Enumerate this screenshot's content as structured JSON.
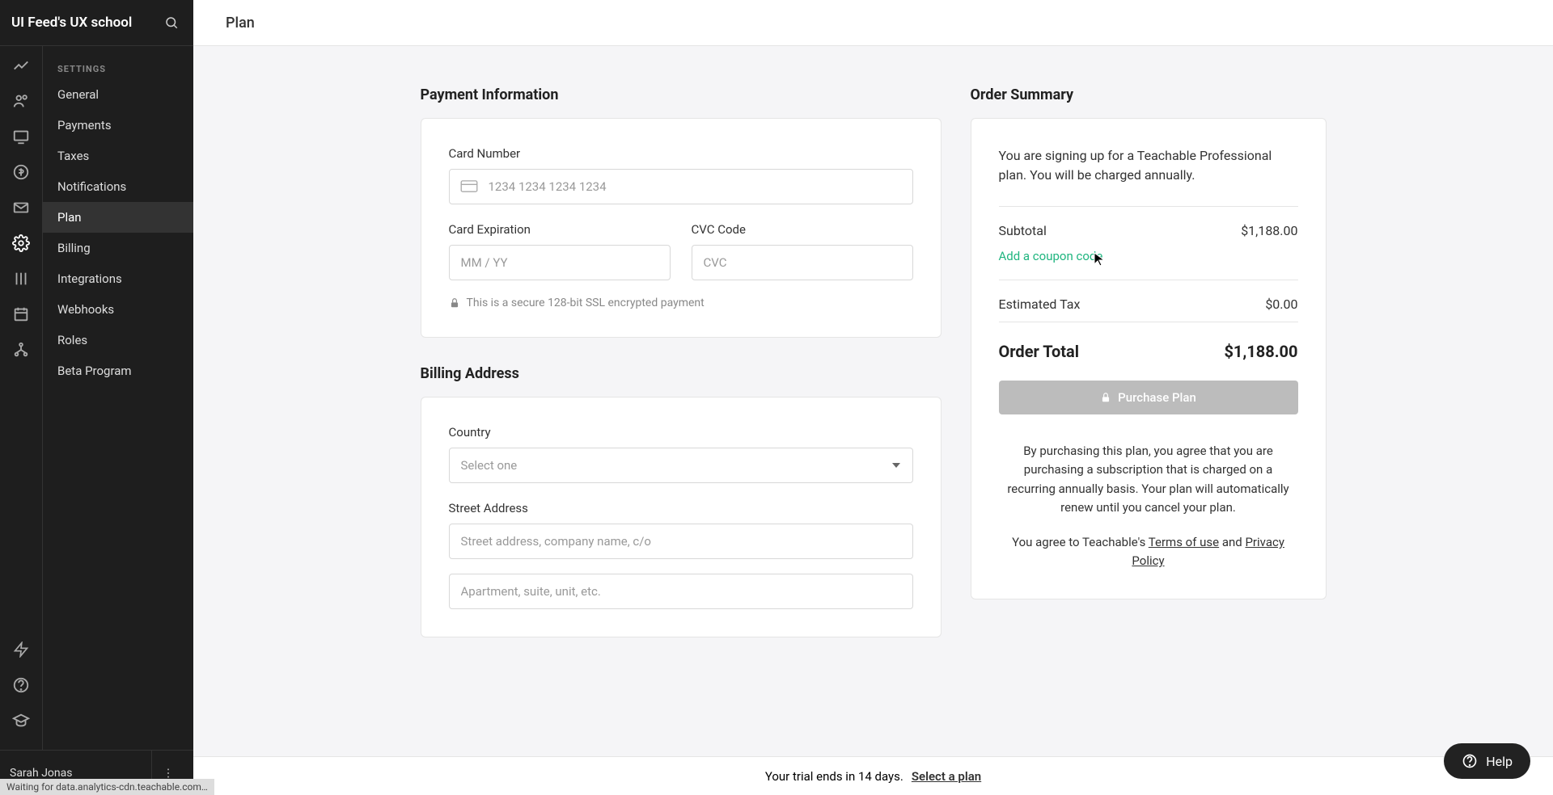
{
  "sidebar": {
    "title": "UI Feed's UX school",
    "heading": "SETTINGS",
    "items": [
      {
        "label": "General"
      },
      {
        "label": "Payments"
      },
      {
        "label": "Taxes"
      },
      {
        "label": "Notifications"
      },
      {
        "label": "Plan"
      },
      {
        "label": "Billing"
      },
      {
        "label": "Integrations"
      },
      {
        "label": "Webhooks"
      },
      {
        "label": "Roles"
      },
      {
        "label": "Beta Program"
      }
    ]
  },
  "user": {
    "name": "Sarah Jonas"
  },
  "topbar": {
    "title": "Plan"
  },
  "payment": {
    "section_title": "Payment Information",
    "card_number_label": "Card Number",
    "card_number_placeholder": "1234 1234 1234 1234",
    "expiration_label": "Card Expiration",
    "expiration_placeholder": "MM / YY",
    "cvc_label": "CVC Code",
    "cvc_placeholder": "CVC",
    "secure_note": "This is a secure 128-bit SSL encrypted payment"
  },
  "billing": {
    "section_title": "Billing Address",
    "country_label": "Country",
    "country_placeholder": "Select one",
    "street_label": "Street Address",
    "street_placeholder": "Street address, company name, c/o",
    "apt_placeholder": "Apartment, suite, unit, etc."
  },
  "summary": {
    "section_title": "Order Summary",
    "description": "You are signing up for a Teachable Professional plan. You will be charged annually.",
    "subtotal_label": "Subtotal",
    "subtotal_value": "$1,188.00",
    "coupon_link": "Add a coupon code",
    "tax_label": "Estimated Tax",
    "tax_value": "$0.00",
    "total_label": "Order Total",
    "total_value": "$1,188.00",
    "purchase_button": "Purchase Plan",
    "legal1": "By purchasing this plan, you agree that you are purchasing a subscription that is charged on a recurring annually basis. Your plan will automatically renew until you cancel your plan.",
    "legal2_pre": "You agree to Teachable's ",
    "legal2_terms": "Terms of use",
    "legal2_and": " and ",
    "legal2_privacy": "Privacy Policy"
  },
  "trial": {
    "message": "Your trial ends in 14 days.",
    "link": "Select a plan"
  },
  "help": {
    "label": "Help"
  },
  "status": "Waiting for data.analytics-cdn.teachable.com…"
}
